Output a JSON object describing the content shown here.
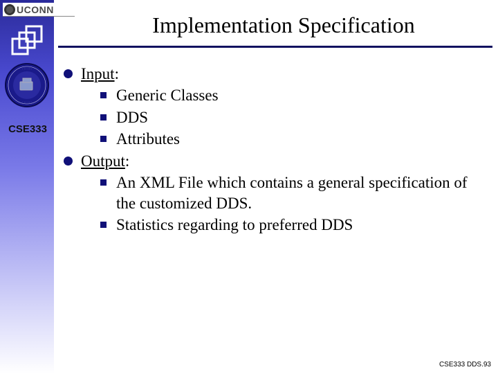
{
  "brand": {
    "text": "UCONN"
  },
  "sidebar": {
    "course_code": "CSE333"
  },
  "title": "Implementation Specification",
  "content": {
    "items": [
      {
        "heading": "Input",
        "sub": [
          "Generic Classes",
          "DDS",
          "Attributes"
        ]
      },
      {
        "heading": "Output",
        "sub": [
          "An XML File which contains a general specification of the customized DDS.",
          "Statistics regarding to preferred DDS"
        ]
      }
    ]
  },
  "footer": "CSE333 DDS.93"
}
